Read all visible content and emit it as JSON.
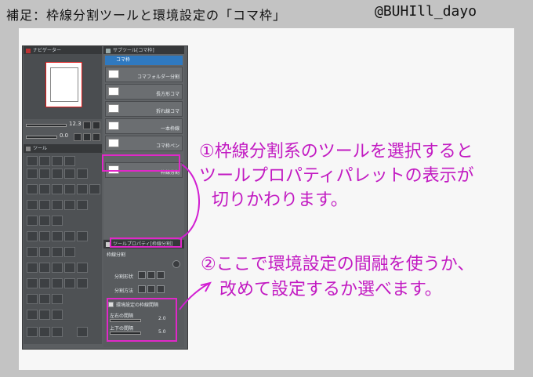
{
  "header": {
    "title": "補足：枠線分割ツールと環境設定の「コマ枠」",
    "handle": "@BUHIll_dayo"
  },
  "navigator": {
    "title": "ナビゲーター",
    "zoom": "12.3",
    "angle": "0.0"
  },
  "tool_panel": {
    "title": "ツール"
  },
  "subtool_panel": {
    "title": "サブツール[コマ枠]",
    "group": "コマ枠",
    "items": [
      "コマフォルダー分割",
      "長方形コマ",
      "折れ線コマ",
      "一本枠線",
      "コマ枠ペン",
      "枠線分割"
    ]
  },
  "tool_property": {
    "title": "ツールプロパティ[枠線分割]",
    "tool_name": "枠線分割",
    "split_shape_label": "分割形状",
    "split_method_label": "分割方法",
    "use_env_gap_label": "環境設定の枠線間隔",
    "horizontal_gap_label": "左右の間隔",
    "horizontal_gap_value": "2.0",
    "vertical_gap_label": "上下の間隔",
    "vertical_gap_value": "5.0"
  },
  "annotations": {
    "note1_line1": "①枠線分割系のツールを選択すると",
    "note1_line2": "ツールプロパティパレットの表示が",
    "note1_line3": "切りかわります。",
    "note2_line1": "②ここで環境設定の間融を使うか、",
    "note2_line2": "改めて設定するか選べます。"
  },
  "colors": {
    "highlight": "#e028c8",
    "annotation_text": "#c21ac2",
    "selected_group": "#2f79c0"
  }
}
